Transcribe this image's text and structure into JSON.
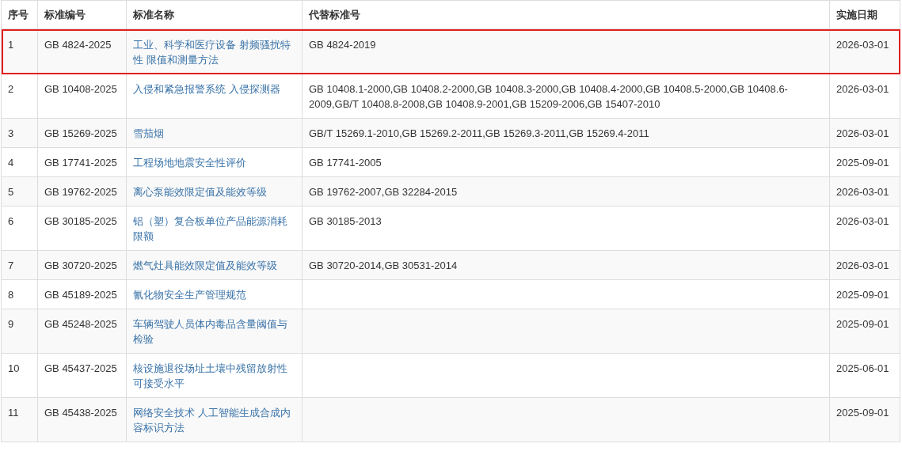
{
  "table": {
    "columns": [
      "序号",
      "标准编号",
      "标准名称",
      "代替标准号",
      "实施日期"
    ],
    "rows": [
      {
        "index": "1",
        "code": "GB 4824-2025",
        "name": "工业、科学和医疗设备 射频骚扰特性 限值和测量方法",
        "replaces": "GB 4824-2019",
        "date": "2026-03-01",
        "selected": true
      },
      {
        "index": "2",
        "code": "GB 10408-2025",
        "name": "入侵和紧急报警系统 入侵探测器",
        "replaces": "GB 10408.1-2000,GB 10408.2-2000,GB 10408.3-2000,GB 10408.4-2000,GB 10408.5-2000,GB 10408.6-2009,GB/T 10408.8-2008,GB 10408.9-2001,GB 15209-2006,GB 15407-2010",
        "date": "2026-03-01",
        "selected": false
      },
      {
        "index": "3",
        "code": "GB 15269-2025",
        "name": "雪茄烟",
        "replaces": "GB/T 15269.1-2010,GB 15269.2-2011,GB 15269.3-2011,GB 15269.4-2011",
        "date": "2026-03-01",
        "selected": false
      },
      {
        "index": "4",
        "code": "GB 17741-2025",
        "name": "工程场地地震安全性评价",
        "replaces": "GB 17741-2005",
        "date": "2025-09-01",
        "selected": false
      },
      {
        "index": "5",
        "code": "GB 19762-2025",
        "name": "离心泵能效限定值及能效等级",
        "replaces": "GB 19762-2007,GB 32284-2015",
        "date": "2026-03-01",
        "selected": false
      },
      {
        "index": "6",
        "code": "GB 30185-2025",
        "name": "铝（塑）复合板单位产品能源消耗限额",
        "replaces": "GB 30185-2013",
        "date": "2026-03-01",
        "selected": false
      },
      {
        "index": "7",
        "code": "GB 30720-2025",
        "name": "燃气灶具能效限定值及能效等级",
        "replaces": "GB 30720-2014,GB 30531-2014",
        "date": "2026-03-01",
        "selected": false
      },
      {
        "index": "8",
        "code": "GB 45189-2025",
        "name": "氰化物安全生产管理规范",
        "date": "2025-09-01",
        "selected": false
      },
      {
        "index": "9",
        "code": "GB 45248-2025",
        "name": "车辆驾驶人员体内毒品含量阈值与检验",
        "date": "2025-09-01",
        "selected": false
      },
      {
        "index": "10",
        "code": "GB 45437-2025",
        "name": "核设施退役场址土壤中残留放射性可接受水平",
        "date": "2025-06-01",
        "selected": false
      },
      {
        "index": "11",
        "code": "GB 45438-2025",
        "name": "网络安全技术 人工智能生成合成内容标识方法",
        "date": "2025-09-01",
        "selected": false
      }
    ]
  }
}
